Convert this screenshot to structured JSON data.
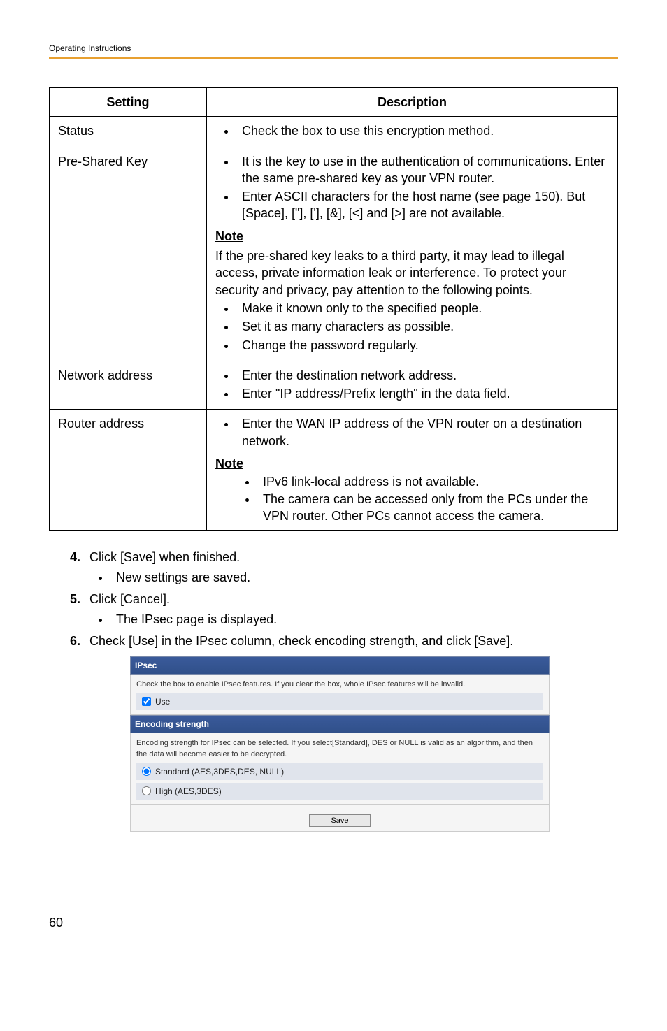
{
  "header": "Operating Instructions",
  "table": {
    "headers": {
      "setting": "Setting",
      "description": "Description"
    },
    "rows": [
      {
        "label": "Status",
        "bullets": [
          "Check the box to use this encryption method."
        ]
      },
      {
        "label": "Pre-Shared Key",
        "bullets": [
          "It is the key to use in the authentication of communications. Enter the same pre-shared key as your VPN router.",
          "Enter ASCII characters for the host name (see page 150). But [Space], [\"], ['], [&], [<] and [>] are not available."
        ],
        "note_label": "Note",
        "note_text": "If the pre-shared key leaks to a third party, it may lead to illegal access, private information leak or interference. To protect your security and privacy, pay attention to the following points.",
        "note_bullets": [
          "Make it known only to the specified people.",
          "Set it as many characters as possible.",
          "Change the password regularly."
        ]
      },
      {
        "label": "Network address",
        "bullets": [
          "Enter the destination network address.",
          "Enter \"IP address/Prefix length\" in the data field."
        ]
      },
      {
        "label": "Router address",
        "bullets": [
          "Enter the WAN IP address of the VPN router on a destination network."
        ],
        "note_label": "Note",
        "sub_bullets": [
          "IPv6 link-local address is not available.",
          "The camera can be accessed only from the PCs under the VPN router. Other PCs cannot access the camera."
        ]
      }
    ]
  },
  "steps": [
    {
      "text": "Click [Save] when finished.",
      "sub": [
        "New settings are saved."
      ]
    },
    {
      "text": "Click [Cancel].",
      "sub": [
        "The IPsec page is displayed."
      ]
    },
    {
      "text": "Check [Use] in the IPsec column, check encoding strength, and click [Save]."
    }
  ],
  "screenshot": {
    "ipsec": {
      "title": "IPsec",
      "desc": "Check the box to enable IPsec features. If you clear the box, whole IPsec features will be invalid.",
      "use_label": "Use"
    },
    "encoding": {
      "title": "Encoding strength",
      "desc": "Encoding strength for IPsec can be selected. If you select[Standard], DES or NULL is valid as an algorithm, and then the data will become easier to be decrypted.",
      "opt1": "Standard (AES,3DES,DES, NULL)",
      "opt2": "High (AES,3DES)"
    },
    "save": "Save"
  },
  "page_number": "60"
}
